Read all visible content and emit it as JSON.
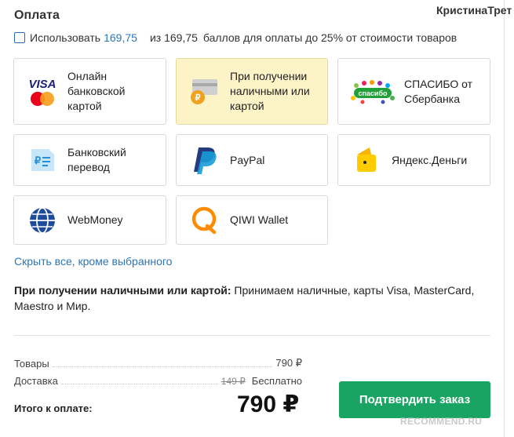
{
  "header": {
    "title": "Оплата",
    "username": "КристинаТрет"
  },
  "points": {
    "checkbox_label": "Использовать",
    "amount_link": "169,75",
    "available": "из 169,75",
    "suffix": "баллов для оплаты до 25% от стоимости товаров"
  },
  "methods": [
    {
      "label": "Онлайн банковской картой",
      "icon": "visa-mastercard-icon",
      "selected": false
    },
    {
      "label": "При получении наличными или картой",
      "icon": "cash-card-icon",
      "selected": true
    },
    {
      "label": "СПАСИБО от Сбербанка",
      "icon": "spasibo-icon",
      "selected": false
    },
    {
      "label": "Банковский перевод",
      "icon": "bank-transfer-icon",
      "selected": false
    },
    {
      "label": "PayPal",
      "icon": "paypal-icon",
      "selected": false
    },
    {
      "label": "Яндекс.Деньги",
      "icon": "yandex-money-icon",
      "selected": false
    },
    {
      "label": "WebMoney",
      "icon": "webmoney-icon",
      "selected": false
    },
    {
      "label": "QIWI Wallet",
      "icon": "qiwi-icon",
      "selected": false
    }
  ],
  "collapse_link": "Скрыть все, кроме выбранного",
  "description": {
    "title": "При получении наличными или картой:",
    "text": "Принимаем наличные, карты Visa, MasterCard, Maestro и Мир."
  },
  "summary": {
    "goods_label": "Товары",
    "goods_value": "790 ₽",
    "delivery_label": "Доставка",
    "delivery_old": "149 ₽",
    "delivery_value": "Бесплатно",
    "total_label": "Итого к оплате:",
    "total_value": "790 ₽"
  },
  "confirm_button": "Подтвердить заказ",
  "watermark": "RECOMMEND.RU",
  "colors": {
    "accent_link": "#2b76b9",
    "confirm_green": "#19a463",
    "selected_bg": "#fcf3c7"
  }
}
